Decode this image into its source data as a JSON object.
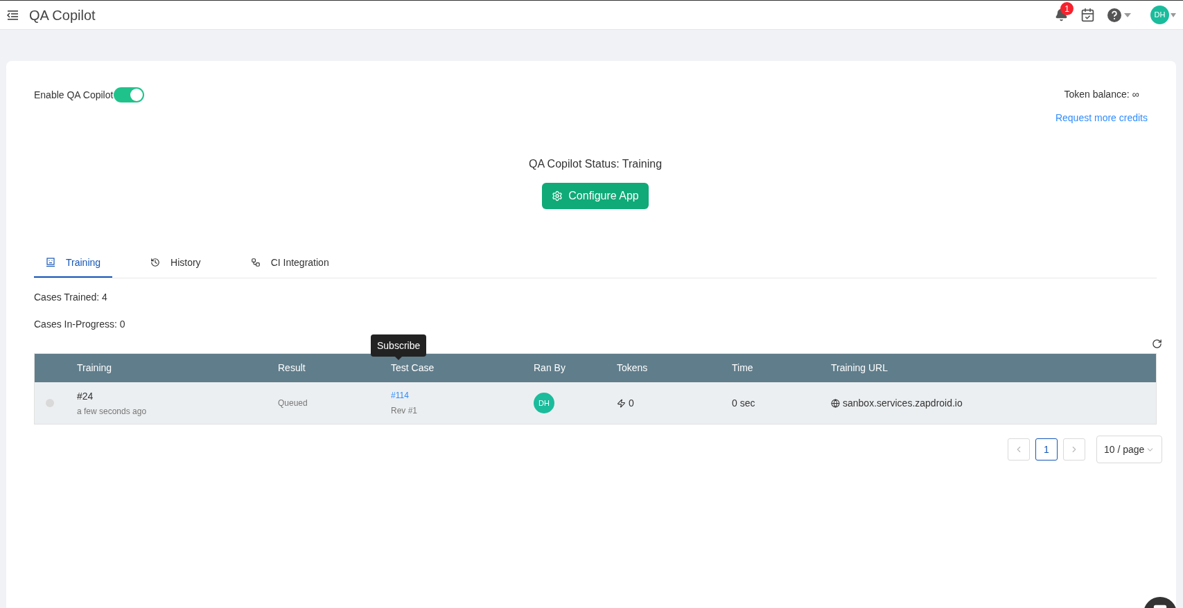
{
  "header": {
    "title": "QA Copilot",
    "notification_count": "1",
    "avatar": "DH"
  },
  "enable": {
    "label": "Enable QA Copilot",
    "on": true
  },
  "token_balance": "Token balance: ∞",
  "request_link": "Request more credits",
  "status": "QA Copilot Status: Training",
  "configure_button": "Configure App",
  "tabs": [
    {
      "label": "Training",
      "selected": true,
      "kind": "training"
    },
    {
      "label": "History",
      "selected": false,
      "kind": "history"
    },
    {
      "label": "CI Integration",
      "selected": false,
      "kind": "ci"
    }
  ],
  "cases_trained": "Cases Trained: 4",
  "cases_in_progress": "Cases In-Progress: 0",
  "table": {
    "columns": [
      "Training",
      "Result",
      "Test Case",
      "Ran By",
      "Tokens",
      "Time",
      "Training URL"
    ],
    "rows": [
      {
        "selected": false,
        "training": "#24",
        "training_time": "a few seconds ago",
        "result": "Queued",
        "test_case": "#114",
        "revision": "Rev #1",
        "ran_by": "DH",
        "tokens": "0",
        "time": "0 sec",
        "url": "sanbox.services.zapdroid.io"
      }
    ]
  },
  "tooltip": "Subscribe",
  "pagination": {
    "pages": [
      {
        "label": "1",
        "selected": true
      }
    ],
    "page_size": "10 / page"
  }
}
